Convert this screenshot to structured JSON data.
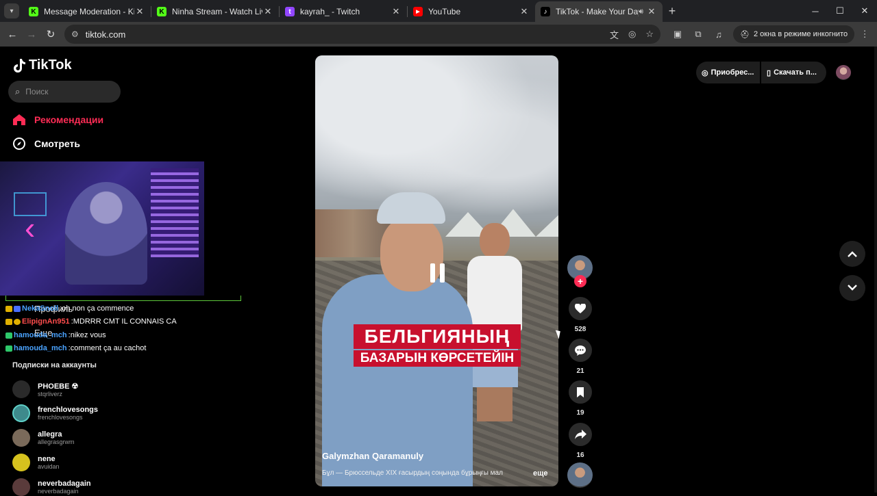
{
  "browser": {
    "tabs": [
      {
        "title": "Message Moderation - Kick Da",
        "favicon_color": "#53fc18",
        "favicon_glyph": "K",
        "active": false
      },
      {
        "title": "Ninha Stream - Watch Live on K",
        "favicon_color": "#53fc18",
        "favicon_glyph": "K",
        "active": false
      },
      {
        "title": "kayrah_ - Twitch",
        "favicon_color": "#9146ff",
        "favicon_glyph": "t",
        "active": false
      },
      {
        "title": "YouTube",
        "favicon_color": "#ff0000",
        "favicon_glyph": "▶",
        "active": false
      },
      {
        "title": "TikTok - Make Your Day",
        "favicon_color": "#000000",
        "favicon_glyph": "♪",
        "active": true
      }
    ],
    "url": "tiktok.com",
    "incognito_label": "2 окна в режиме инкогнито"
  },
  "sidebar": {
    "logo": "TikTok",
    "search_placeholder": "Поиск",
    "nav": [
      {
        "label": "Рекомендации",
        "icon": "home-icon",
        "active": true
      },
      {
        "label": "Смотреть",
        "icon": "compass-icon",
        "active": false
      }
    ],
    "ghost_profile": "Профиль",
    "ghost_more": "Еще",
    "following_header": "Подписки на аккаунты",
    "following": [
      {
        "name": "PHOEBE ☢",
        "handle": "stqrliverz",
        "avatar_color": "#2a2a2a"
      },
      {
        "name": "frenchlovesongs",
        "handle": "frenchlovesongs",
        "avatar_color": "#3e8a8c"
      },
      {
        "name": "allegra",
        "handle": "allegrasgrwm",
        "avatar_color": "#7a6a5a"
      },
      {
        "name": "nene",
        "handle": "avuidan",
        "avatar_color": "#d6c21e"
      },
      {
        "name": "neverbadagain",
        "handle": "neverbadagain",
        "avatar_color": "#5a3b3b"
      }
    ]
  },
  "overlay_chat": [
    {
      "user": "NekaSnoll",
      "message": "oh non ça commence",
      "user_color": "#4aa3ff"
    },
    {
      "user": "ElipignAn951",
      "message": "MDRRR CMT IL CONNAIS CA",
      "user_color": "#ff4d4d"
    },
    {
      "user": "hamouda_mch",
      "message": "nikez vous",
      "user_color": "#4aa3ff"
    },
    {
      "user": "hamouda_mch",
      "message": "comment ça au cachot",
      "user_color": "#4aa3ff"
    }
  ],
  "video": {
    "caption_line1": "БЕЛЬГИЯНЫҢ",
    "caption_line2": "БАЗАРЫН КӨРСЕТЕЙІН",
    "author": "Galymzhan Qaramanuly",
    "description": "Бұл — Брюссельде XIX ғасырдың соңында бұрыңғы мал",
    "more": "еще"
  },
  "actions": [
    {
      "name": "like",
      "icon": "heart-icon",
      "count": "528"
    },
    {
      "name": "comment",
      "icon": "comment-icon",
      "count": "21"
    },
    {
      "name": "favorite",
      "icon": "bookmark-icon",
      "count": "19"
    },
    {
      "name": "share",
      "icon": "share-icon",
      "count": "16"
    }
  ],
  "topright": {
    "coins_label": "Приобрес...",
    "download_label": "Скачать п..."
  },
  "colors": {
    "accent": "#fe2c55",
    "chat_border": "#5ec93b"
  }
}
